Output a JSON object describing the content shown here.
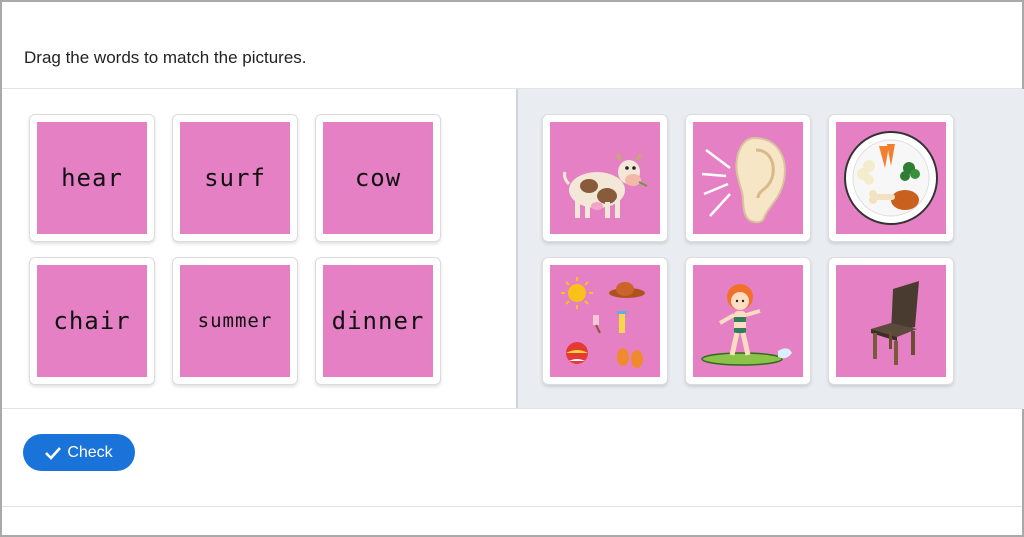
{
  "instruction": "Drag the words to match the pictures.",
  "word_cards": [
    {
      "label": "hear"
    },
    {
      "label": "surf"
    },
    {
      "label": "cow"
    },
    {
      "label": "chair"
    },
    {
      "label": "summer"
    },
    {
      "label": "dinner"
    }
  ],
  "picture_cards": [
    {
      "icon": "cow-icon"
    },
    {
      "icon": "ear-icon"
    },
    {
      "icon": "dinner-plate-icon"
    },
    {
      "icon": "summer-items-icon"
    },
    {
      "icon": "surfer-girl-icon"
    },
    {
      "icon": "chair-icon"
    }
  ],
  "check_button": {
    "label": "Check",
    "icon": "checkmark-icon"
  },
  "colors": {
    "card_fill": "#e580c4",
    "button": "#1a73d9",
    "right_panel": "#e9edf2"
  }
}
